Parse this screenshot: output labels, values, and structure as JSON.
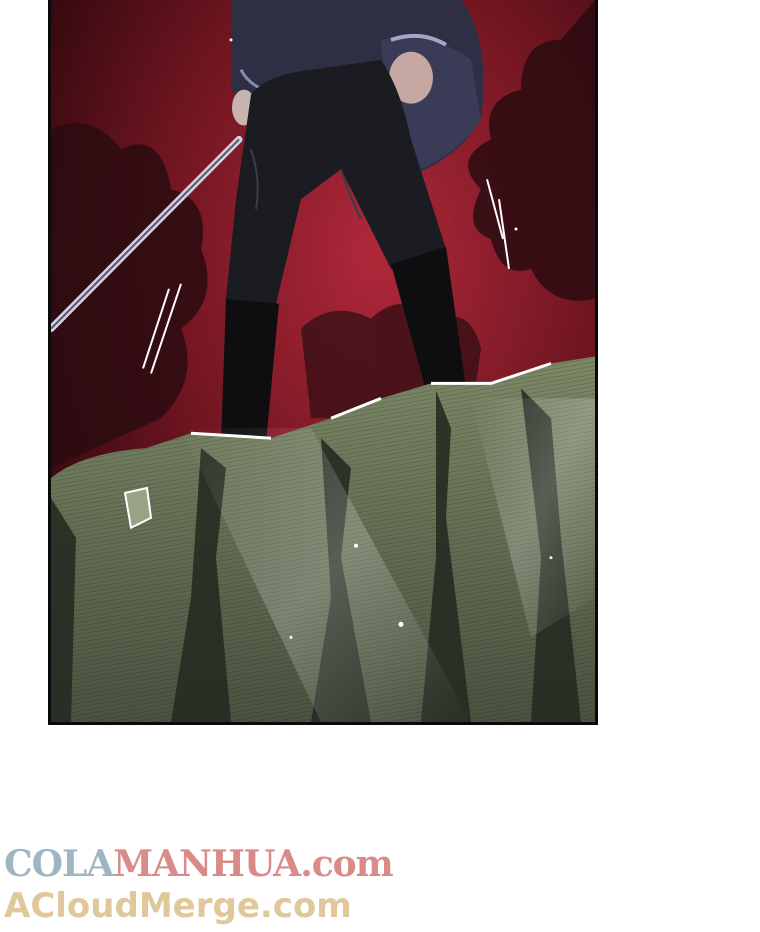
{
  "panel": {
    "scene": "comic-panel",
    "colors": {
      "sky": "#5a0d16",
      "sky_glow": "#a0232e",
      "foliage": "#2a0f12",
      "coat": "#2e2f45",
      "trousers": "#1b1c22",
      "boots": "#0e0e10",
      "sword": "#b9b6c8",
      "rock": "#6a7457",
      "rock_dark": "#3b4233"
    }
  },
  "watermark": {
    "part1": "COLA",
    "part2": "MANHUA",
    "part3": ".com",
    "line2": "ACloudMerge.com",
    "colors": {
      "cola": "#9fb6c2",
      "manhua": "#d98b8a",
      "line2": "#e0c89c"
    }
  }
}
